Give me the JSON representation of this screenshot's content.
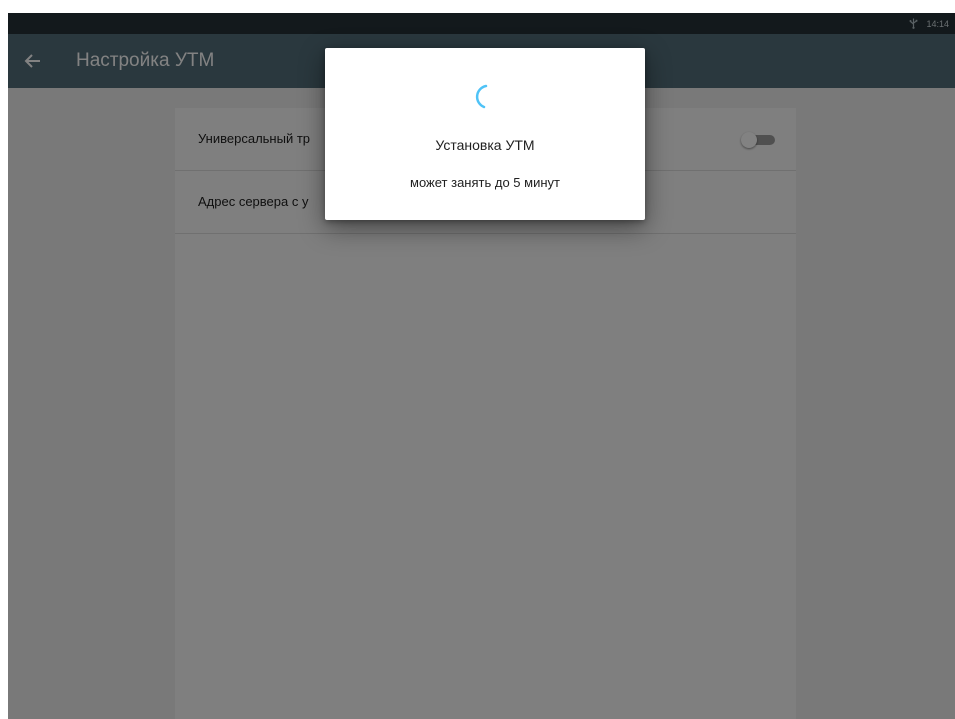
{
  "status_bar": {
    "icons": [
      "usb-icon"
    ],
    "time": "14:14",
    "background": "#263238"
  },
  "app_bar": {
    "back_icon": "arrow-left-icon",
    "title": "Настройка УТМ",
    "background": "#546e7a"
  },
  "settings": {
    "rows": [
      {
        "label": "Универсальный тр",
        "control": "toggle",
        "toggle_on": false
      },
      {
        "label": "Адрес сервера с у"
      }
    ]
  },
  "dialog": {
    "spinner_icon": "loading-spinner-icon",
    "spinner_color": "#4fc3f7",
    "title": "Установка УТМ",
    "message": "может занять до 5 минут"
  }
}
